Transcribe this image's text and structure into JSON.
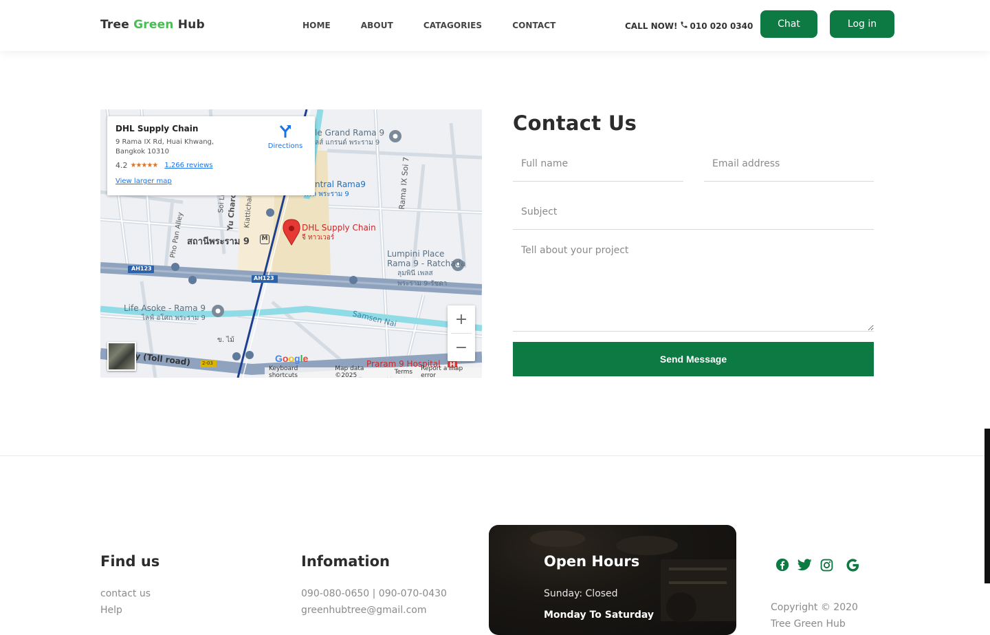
{
  "header": {
    "brand_part1": "Tree",
    "brand_part2": "Green",
    "brand_part3": "Hub",
    "nav": [
      "HOME",
      "ABOUT",
      "CATAGORIES",
      "CONTACT"
    ],
    "call_label": "CALL NOW!",
    "phone": "010 020 0340",
    "chat_label": "Chat",
    "login_label": "Log in"
  },
  "map": {
    "place_name": "DHL Supply Chain",
    "address_line1": "9 Rama IX Rd, Huai Khwang,",
    "address_line2": "Bangkok 10310",
    "rating": "4.2",
    "stars": "★★★★★",
    "reviews": "1,266 reviews",
    "view_larger": "View larger map",
    "directions": "Directions",
    "zoom_in": "+",
    "zoom_out": "−",
    "logo": "Google",
    "attribution": [
      "Keyboard shortcuts",
      "Map data ©2025",
      "Terms",
      "Report a map error"
    ],
    "labels": {
      "pin_en": "DHL Supply Chain",
      "pin_th": "จี ทาวเวอร์",
      "grand": "le Grand Rama 9",
      "grand_th": "ลส์ แกรนด์ พระราม 9",
      "central": "ntral Rama9",
      "central_th": "ทรัล พระราม 9",
      "station": "สถานีพระราม 9",
      "lumpini1": "Lumpini Place",
      "lumpini2": "Rama 9 - Ratchada",
      "lumpini_th": "ลุมพินี เพลส พระราม 9-รัชดา",
      "life": "Life Asoke - Rama 9",
      "life_th": "ไลฟ์ อโศก พระราม 9",
      "samsen": "Samsen Nai",
      "toll": "y (Toll road)",
      "praram": "Praram 9 Hospital",
      "ah123": "AH123",
      "rama9soi": "Rama IX Soi 7",
      "pho_pan": "Pho Pan Alley",
      "yu_charo": "Yu Charo",
      "kiattichai": "Kiattichai",
      "soi_li": "Soi Li",
      "road_203": "2-03",
      "metro": "M",
      "hospital": "H",
      "yaek": "ข. ไม้"
    }
  },
  "contact": {
    "title": "Contact Us",
    "name_placeholder": "Full name",
    "email_placeholder": "Email address",
    "subject_placeholder": "Subject",
    "message_placeholder": "Tell about your project",
    "send_label": "Send Message"
  },
  "footer": {
    "find_title": "Find us",
    "find_links": [
      "contact us",
      "Help"
    ],
    "info_title": "Infomation",
    "info_phone": "090-080-0650 | 090-070-0430",
    "info_email": "greenhubtree@gmail.com",
    "hours_title": "Open Hours",
    "hours_sunday": "Sunday: Closed",
    "hours_weekday": "Monday To Saturday",
    "social": [
      "facebook-icon",
      "twitter-icon",
      "instagram-icon",
      "google-icon"
    ],
    "copyright": "Copyright © 2020",
    "copyright_line2": "Tree Green Hub"
  },
  "colors": {
    "brand_green": "#0d7a43",
    "accent_green": "#4cbb55",
    "pin_red": "#e53935"
  }
}
